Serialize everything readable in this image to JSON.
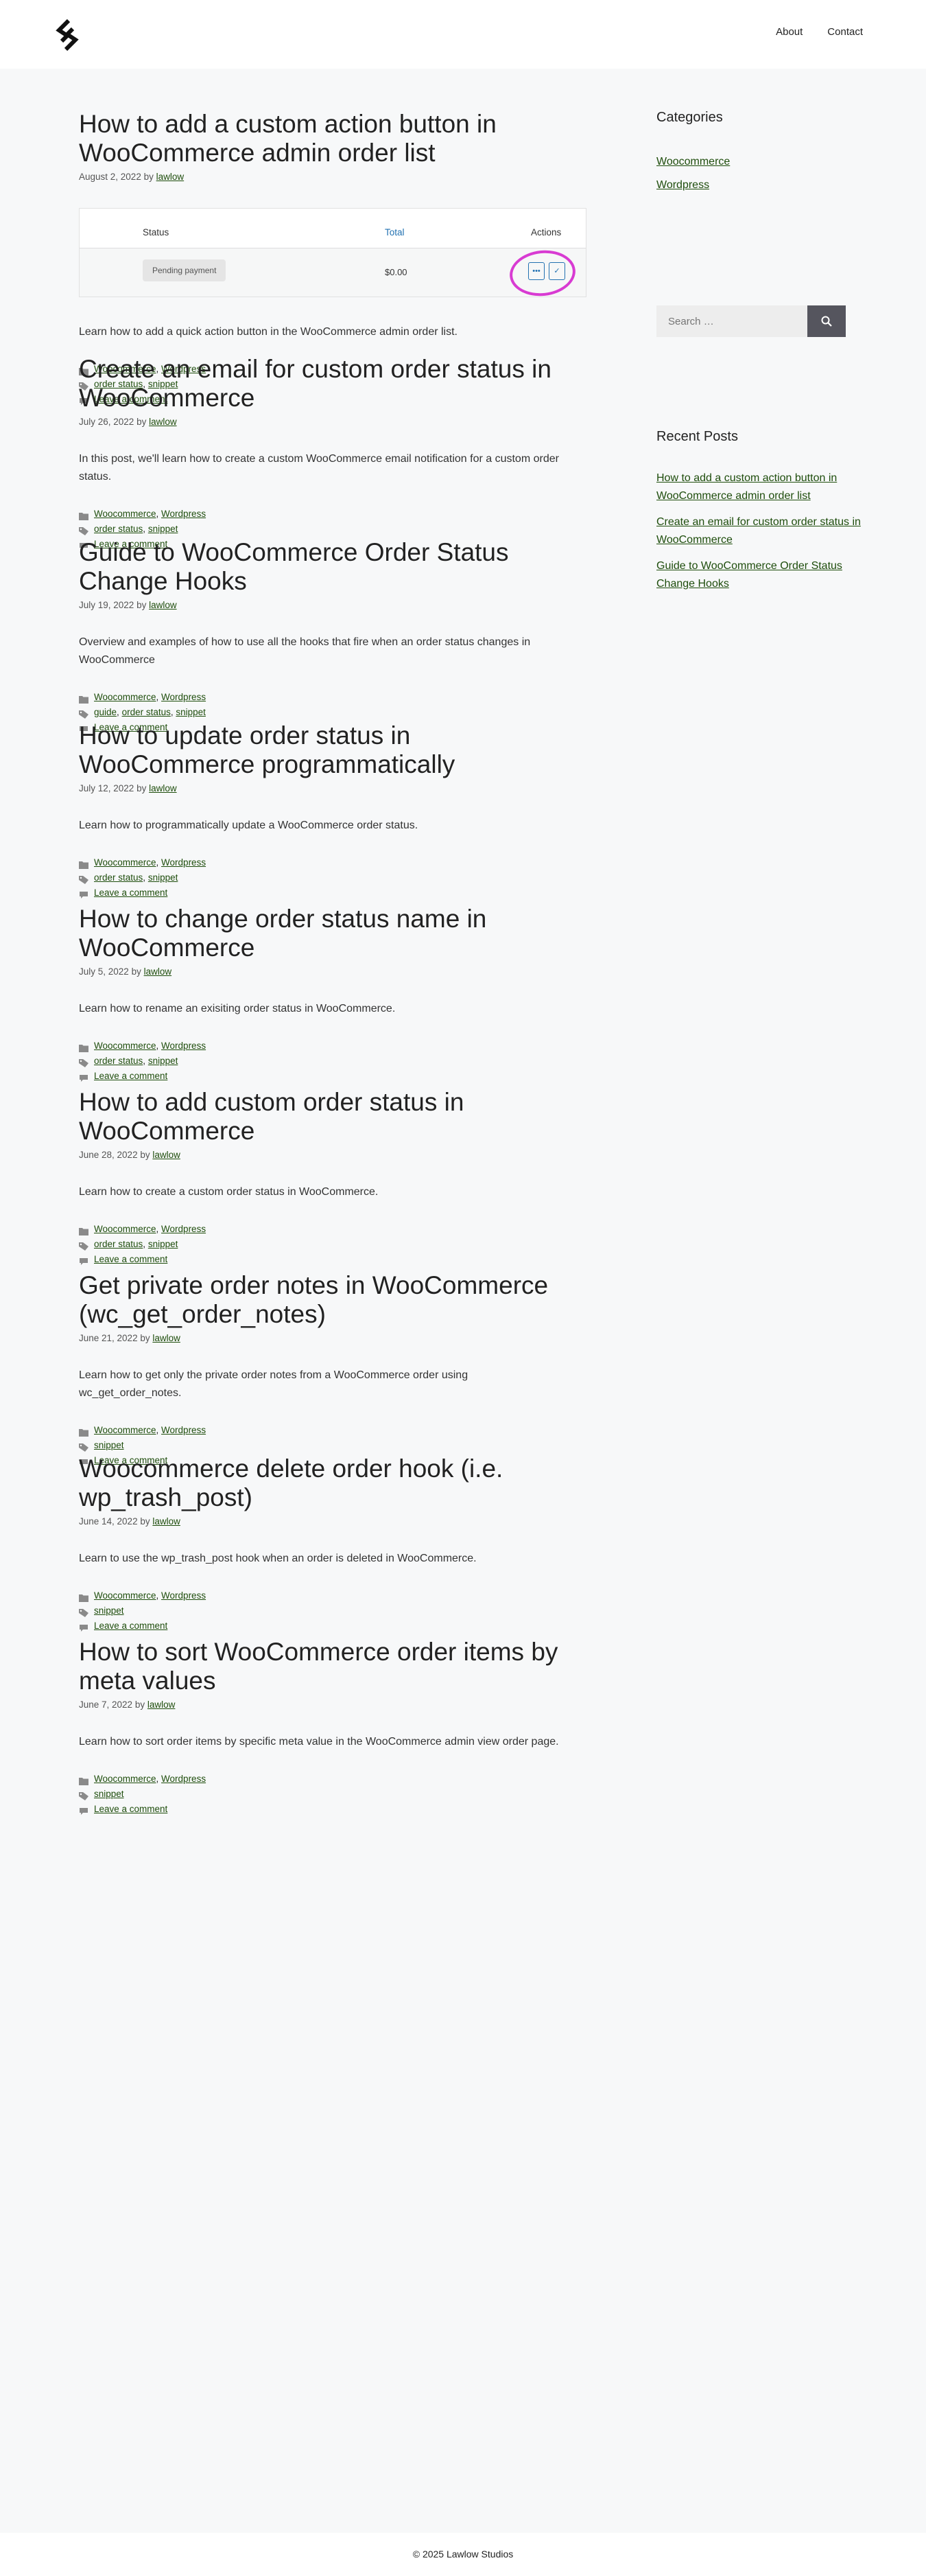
{
  "nav": {
    "links": [
      "About",
      "Contact"
    ]
  },
  "articles": [
    {
      "title": "How to add a custom action button in WooCommerce admin order list",
      "date": "August 2, 2022",
      "by": "by",
      "author": "lawlow",
      "summary": "Learn how to add a quick action button in the WooCommerce admin order list.",
      "categories": [
        "Woocommerce",
        "Wordpress"
      ],
      "tags": [
        "order status",
        "snippet"
      ],
      "comment": "Leave a comment",
      "featured": {
        "col_status": "Status",
        "col_total": "Total",
        "col_actions": "Actions",
        "status_badge": "Pending payment",
        "amount": "$0.00",
        "btn1": "•••",
        "btn2": "✓"
      }
    },
    {
      "title": "Create an email for custom order status in WooCommerce",
      "date": "July 26, 2022",
      "by": "by",
      "author": "lawlow",
      "summary": "In this post, we'll learn how to create a custom WooCommerce email notification for a custom order status.",
      "categories": [
        "Woocommerce",
        "Wordpress"
      ],
      "tags": [
        "order status",
        "snippet"
      ],
      "comment": "Leave a comment"
    },
    {
      "title": "Guide to WooCommerce Order Status Change Hooks",
      "date": "July 19, 2022",
      "by": "by",
      "author": "lawlow",
      "summary": "Overview and examples of how to use all the hooks that fire when an order status changes in WooCommerce",
      "categories": [
        "Woocommerce",
        "Wordpress"
      ],
      "tags": [
        "guide",
        "order status",
        "snippet"
      ],
      "comment": "Leave a comment"
    },
    {
      "title": "How to update order status in WooCommerce programmatically",
      "date": "July 12, 2022",
      "by": "by",
      "author": "lawlow",
      "summary": "Learn how to programmatically update a WooCommerce order status.",
      "categories": [
        "Woocommerce",
        "Wordpress"
      ],
      "tags": [
        "order status",
        "snippet"
      ],
      "comment": "Leave a comment"
    },
    {
      "title": "How to change order status name in WooCommerce",
      "date": "July 5, 2022",
      "by": "by",
      "author": "lawlow",
      "summary": "Learn how to rename an exisiting order status in WooCommerce.",
      "categories": [
        "Woocommerce",
        "Wordpress"
      ],
      "tags": [
        "order status",
        "snippet"
      ],
      "comment": "Leave a comment"
    },
    {
      "title": "How to add custom order status in WooCommerce",
      "date": "June 28, 2022",
      "by": "by",
      "author": "lawlow",
      "summary": "Learn how to create a custom order status in WooCommerce.",
      "categories": [
        "Woocommerce",
        "Wordpress"
      ],
      "tags": [
        "order status",
        "snippet"
      ],
      "comment": "Leave a comment"
    },
    {
      "title": "Get private order notes in WooCommerce (wc_get_order_notes)",
      "date": "June 21, 2022",
      "by": "by",
      "author": "lawlow",
      "summary": "Learn how to get only the private order notes from a WooCommerce order using wc_get_order_notes.",
      "categories": [
        "Woocommerce",
        "Wordpress"
      ],
      "tags": [
        "snippet"
      ],
      "comment": "Leave a comment"
    },
    {
      "title": "Woocommerce delete order hook (i.e. wp_trash_post)",
      "date": "June 14, 2022",
      "by": "by",
      "author": "lawlow",
      "summary": "Learn to use the wp_trash_post hook when an order is deleted in WooCommerce.",
      "categories": [
        "Woocommerce",
        "Wordpress"
      ],
      "tags": [
        "snippet"
      ],
      "comment": "Leave a comment"
    },
    {
      "title": "How to sort WooCommerce order items by meta values",
      "date": "June 7, 2022",
      "by": "by",
      "author": "lawlow",
      "summary": "Learn how to sort order items by specific meta value in the WooCommerce admin view order page.",
      "categories": [
        "Woocommerce",
        "Wordpress"
      ],
      "tags": [
        "snippet"
      ],
      "comment": "Leave a comment"
    }
  ],
  "sidebar": {
    "categories_title": "Categories",
    "categories": [
      "Woocommerce",
      "Wordpress"
    ],
    "search_placeholder": "Search …",
    "recent_title": "Recent Posts",
    "recent": [
      "How to add a custom action button in WooCommerce admin order list",
      "Create an email for custom order status in WooCommerce",
      "Guide to WooCommerce Order Status Change Hooks"
    ]
  },
  "footer": {
    "copyright": "© 2025 Lawlow Studios"
  },
  "colors": {
    "link": "#1e4d0c",
    "background": "#f7f8f9",
    "search_button": "#55555e",
    "highlight_circle": "#d83bd2"
  }
}
